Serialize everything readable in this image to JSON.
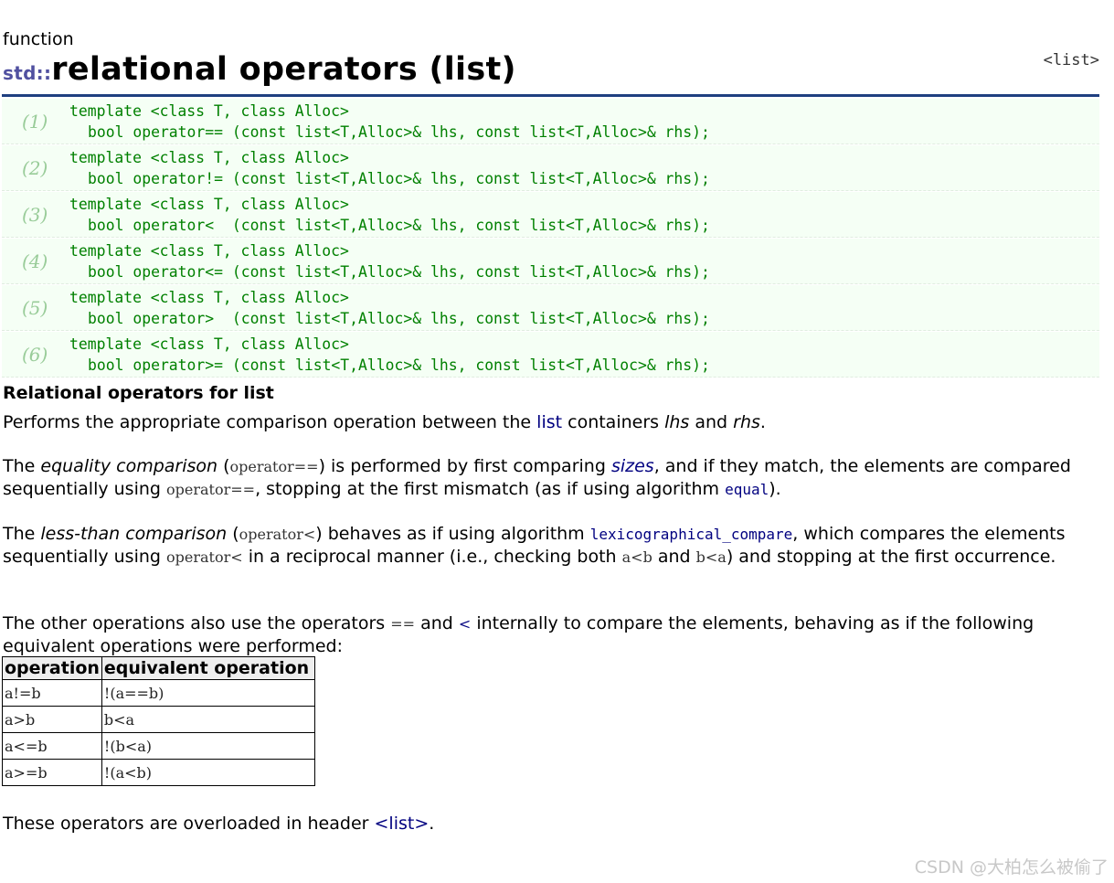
{
  "kind": "function",
  "title_ns": "std::",
  "title": "relational operators (list)",
  "header_link": "<list>",
  "prototypes": [
    {
      "num": "(1)",
      "line1": "template <class T, class Alloc>",
      "line2": "bool operator== (const list<T,Alloc>& lhs, const list<T,Alloc>& rhs);"
    },
    {
      "num": "(2)",
      "line1": "template <class T, class Alloc>",
      "line2": "bool operator!= (const list<T,Alloc>& lhs, const list<T,Alloc>& rhs);"
    },
    {
      "num": "(3)",
      "line1": "template <class T, class Alloc>",
      "line2": "bool operator<  (const list<T,Alloc>& lhs, const list<T,Alloc>& rhs);"
    },
    {
      "num": "(4)",
      "line1": "template <class T, class Alloc>",
      "line2": "bool operator<= (const list<T,Alloc>& lhs, const list<T,Alloc>& rhs);"
    },
    {
      "num": "(5)",
      "line1": "template <class T, class Alloc>",
      "line2": "bool operator>  (const list<T,Alloc>& lhs, const list<T,Alloc>& rhs);"
    },
    {
      "num": "(6)",
      "line1": "template <class T, class Alloc>",
      "line2": "bool operator>= (const list<T,Alloc>& lhs, const list<T,Alloc>& rhs);"
    }
  ],
  "subtitle": "Relational operators for list",
  "p1": {
    "a": "Performs the appropriate comparison operation between the ",
    "link": "list",
    "b": " containers ",
    "lhs": "lhs",
    "c": " and ",
    "rhs": "rhs",
    "d": "."
  },
  "p2": {
    "a": "The ",
    "em": "equality comparison",
    "b": " (",
    "op1": "operator==",
    "c": ") is performed by first comparing ",
    "sizes": "sizes",
    "d": ", and if they match, the elements are compared sequentially using ",
    "op2": "operator==",
    "e": ", stopping at the first mismatch (as if using algorithm ",
    "equal": "equal",
    "f": ")."
  },
  "p3": {
    "a": "The ",
    "em": "less-than comparison",
    "b": " (",
    "op1": "operator<",
    "c": ") behaves as if using algorithm ",
    "lex": "lexicographical_compare",
    "d": ", which compares the elements sequentially using ",
    "op2": "operator<",
    "e": " in a reciprocal manner (i.e., checking both ",
    "ab": "a<b",
    "f": " and ",
    "ba": "b<a",
    "g": ") and stopping at the first occurrence."
  },
  "p4": {
    "a": "The other operations also use the operators ",
    "eq": "==",
    "b": " and ",
    "lt": "<",
    "c": " internally to compare the elements, behaving as if the following equivalent operations were performed:"
  },
  "table": {
    "headers": [
      "operation",
      "equivalent operation"
    ],
    "rows": [
      [
        "a!=b",
        "!(a==b)"
      ],
      [
        "a>b",
        "b<a"
      ],
      [
        "a<=b",
        "!(b<a)"
      ],
      [
        "a>=b",
        "!(a<b)"
      ]
    ]
  },
  "p5": {
    "a": "These operators are overloaded in header ",
    "link": "<list>",
    "b": "."
  },
  "watermark": "CSDN @大柏怎么被偷了"
}
